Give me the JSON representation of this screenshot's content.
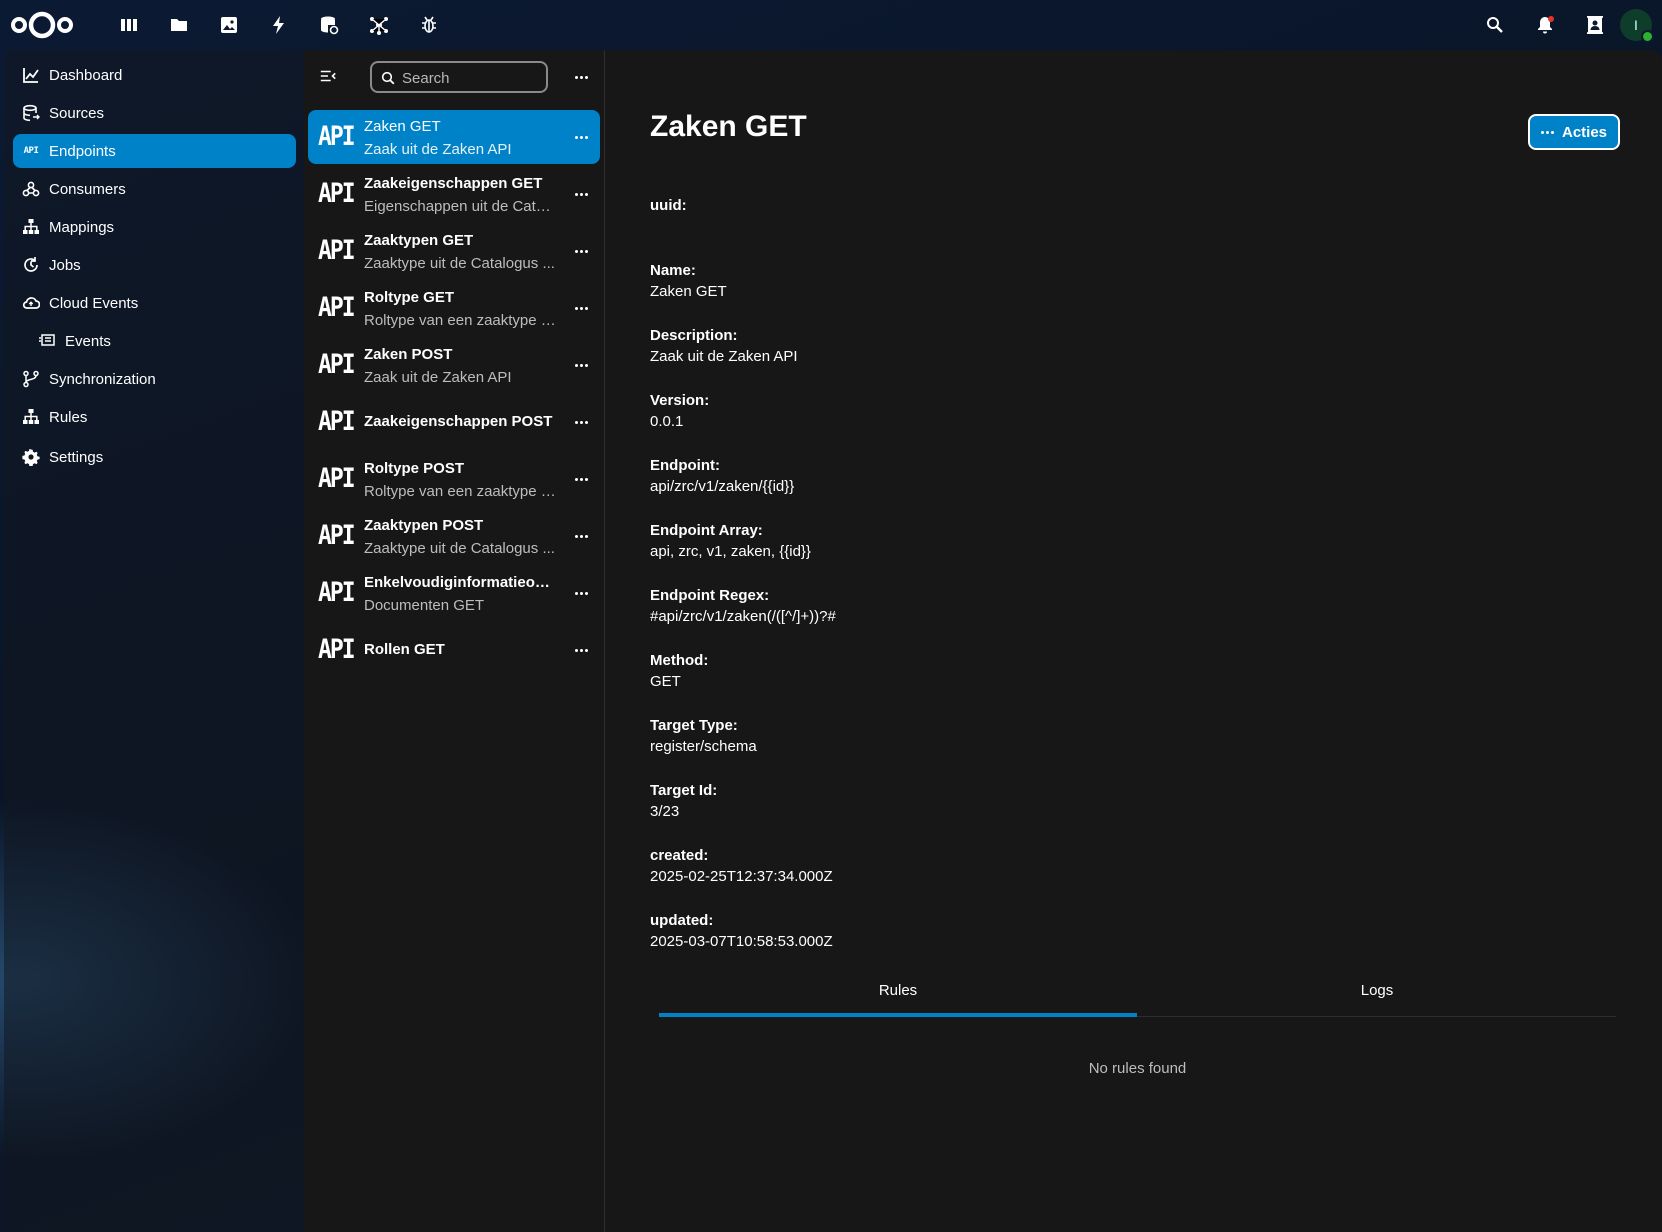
{
  "header": {
    "apps": [
      {
        "name": "dashboard-app-icon"
      },
      {
        "name": "files-app-icon"
      },
      {
        "name": "photos-app-icon"
      },
      {
        "name": "activity-app-icon"
      },
      {
        "name": "database-app-icon"
      },
      {
        "name": "hub-app-icon"
      },
      {
        "name": "bug-app-icon"
      }
    ],
    "avatar_initial": "I"
  },
  "nav": {
    "items": [
      {
        "label": "Dashboard",
        "icon": "chart-icon"
      },
      {
        "label": "Sources",
        "icon": "database-icon"
      },
      {
        "label": "Endpoints",
        "icon": "api-icon",
        "active": true
      },
      {
        "label": "Consumers",
        "icon": "webhook-icon"
      },
      {
        "label": "Mappings",
        "icon": "sitemap-icon"
      },
      {
        "label": "Jobs",
        "icon": "timer-icon"
      },
      {
        "label": "Cloud Events",
        "icon": "cloud-icon"
      },
      {
        "label": "Events",
        "icon": "message-text-icon"
      },
      {
        "label": "Synchronization",
        "icon": "source-branch-icon"
      },
      {
        "label": "Rules",
        "icon": "sitemap-icon"
      }
    ],
    "settings_label": "Settings"
  },
  "list": {
    "search_placeholder": "Search",
    "api_label": "API",
    "endpoints": [
      {
        "title": "Zaken GET",
        "subtitle": "Zaak uit de Zaken API",
        "active": true
      },
      {
        "title": "Zaakeigenschappen GET",
        "subtitle": "Eigenschappen uit de Catal..."
      },
      {
        "title": "Zaaktypen GET",
        "subtitle": "Zaaktype uit de Catalogus ..."
      },
      {
        "title": "Roltype GET",
        "subtitle": "Roltype van een zaaktype u..."
      },
      {
        "title": "Zaken POST",
        "subtitle": "Zaak uit de Zaken API"
      },
      {
        "title": "Zaakeigenschappen POST",
        "subtitle": ""
      },
      {
        "title": "Roltype POST",
        "subtitle": "Roltype van een zaaktype u..."
      },
      {
        "title": "Zaaktypen POST",
        "subtitle": "Zaaktype uit de Catalogus ..."
      },
      {
        "title": "Enkelvoudiginformatieobj...",
        "subtitle": "Documenten GET"
      },
      {
        "title": "Rollen GET",
        "subtitle": ""
      }
    ]
  },
  "detail": {
    "title": "Zaken GET",
    "actions_label": "Acties",
    "fields": [
      {
        "label": "uuid:",
        "value": ""
      },
      {
        "label": "Name:",
        "value": "Zaken GET"
      },
      {
        "label": "Description:",
        "value": "Zaak uit de Zaken API"
      },
      {
        "label": "Version:",
        "value": "0.0.1"
      },
      {
        "label": "Endpoint:",
        "value": "api/zrc/v1/zaken/{{id}}"
      },
      {
        "label": "Endpoint Array:",
        "value": "api, zrc, v1, zaken, {{id}}"
      },
      {
        "label": "Endpoint Regex:",
        "value": "#api/zrc/v1/zaken(/([^/]+))?#"
      },
      {
        "label": "Method:",
        "value": "GET"
      },
      {
        "label": "Target Type:",
        "value": "register/schema"
      },
      {
        "label": "Target Id:",
        "value": "3/23"
      },
      {
        "label": "created:",
        "value": "2025-02-25T12:37:34.000Z"
      },
      {
        "label": "updated:",
        "value": "2025-03-07T10:58:53.000Z"
      }
    ],
    "tabs": [
      {
        "label": "Rules",
        "active": true
      },
      {
        "label": "Logs"
      }
    ],
    "empty_message": "No rules found"
  },
  "colors": {
    "accent": "#0082c9",
    "panel_bg": "#171717",
    "header_bg": "#0d1a2e"
  }
}
